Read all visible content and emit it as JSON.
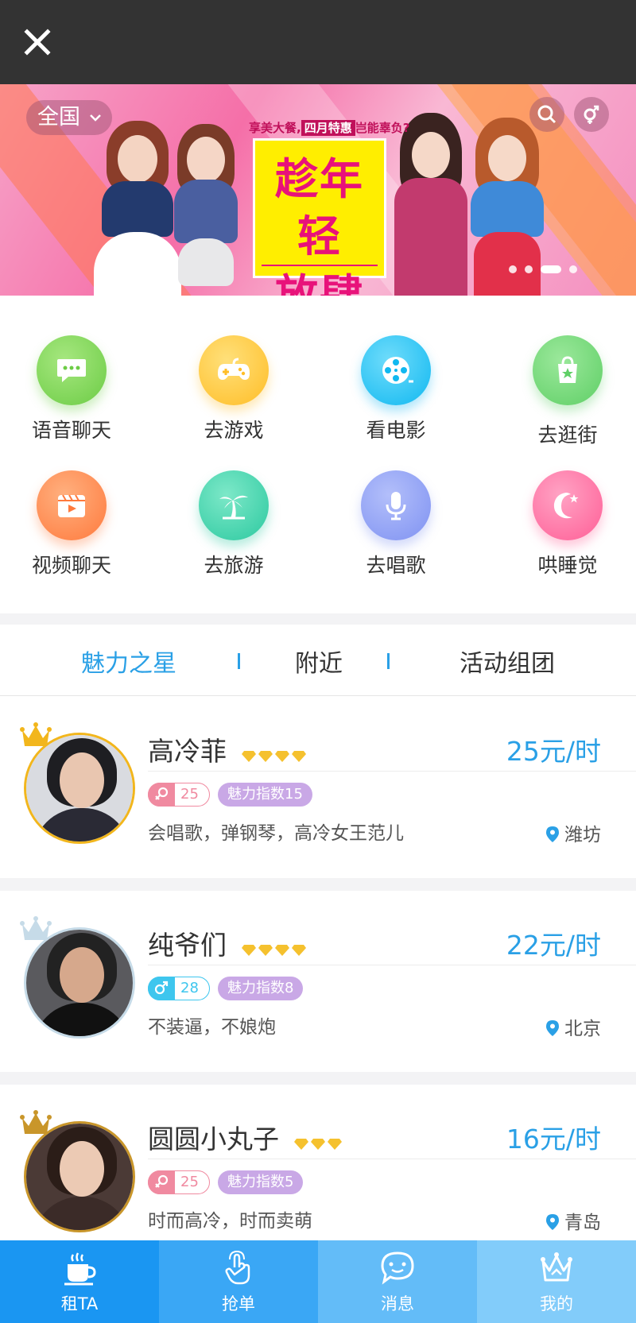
{
  "header": {
    "close_icon": "close-icon"
  },
  "banner": {
    "region": "全国",
    "promo_small": "享美大餐,",
    "promo_highlight": "四月特惠",
    "promo_tail": "岂能辜负?",
    "promo_line1": "趁年轻",
    "promo_line2": "放肆美",
    "search_icon": "search-icon",
    "gender_icon": "gender-icon"
  },
  "categories": [
    {
      "label": "语音聊天",
      "icon": "chat-bubble-icon",
      "color": "#7fd45a"
    },
    {
      "label": "去游戏",
      "icon": "gamepad-icon",
      "color": "#ffc73a"
    },
    {
      "label": "看电影",
      "icon": "film-reel-icon",
      "color": "#1fc4f6"
    },
    {
      "label": "去逛街",
      "icon": "shopping-bag-icon",
      "color": "#6fd46f"
    },
    {
      "label": "视频聊天",
      "icon": "video-icon",
      "color": "#ff8a4f"
    },
    {
      "label": "去旅游",
      "icon": "palm-tree-icon",
      "color": "#3fd3a8"
    },
    {
      "label": "去唱歌",
      "icon": "microphone-icon",
      "color": "#8b9ff5"
    },
    {
      "label": "哄睡觉",
      "icon": "moon-icon",
      "color": "#ff6fa3"
    }
  ],
  "tabs": {
    "star": "魅力之星",
    "nearby": "附近",
    "group": "活动组团"
  },
  "users": [
    {
      "name": "高冷菲",
      "price": "25元/时",
      "age": "25",
      "gender": "female",
      "charm": "魅力指数15",
      "desc": "会唱歌，弹钢琴，高冷女王范儿",
      "location": "潍坊",
      "gems": 4,
      "crown": "gold-crown-icon"
    },
    {
      "name": "纯爷们",
      "price": "22元/时",
      "age": "28",
      "gender": "male",
      "charm": "魅力指数8",
      "desc": "不装逼，不娘炮",
      "location": "北京",
      "gems": 4,
      "crown": "silver-crown-icon"
    },
    {
      "name": "圆圆小丸子",
      "price": "16元/时",
      "age": "25",
      "gender": "female",
      "charm": "魅力指数5",
      "desc": "时而高冷，时而卖萌",
      "location": "青岛",
      "gems": 3,
      "crown": "bronze-crown-icon"
    }
  ],
  "bottom_nav": [
    {
      "label": "租TA",
      "icon": "coffee-cup-icon",
      "bg": "#1a96f2"
    },
    {
      "label": "抢单",
      "icon": "tap-hand-icon",
      "bg": "#3aa7f5"
    },
    {
      "label": "消息",
      "icon": "message-icon",
      "bg": "#63bcf8"
    },
    {
      "label": "我的",
      "icon": "crown-icon",
      "bg": "#82ccfa"
    }
  ],
  "colors": {
    "accent": "#2aa0e6",
    "female": "#f08aa0",
    "male": "#3ec6ee",
    "charm": "#c9a8e6"
  }
}
